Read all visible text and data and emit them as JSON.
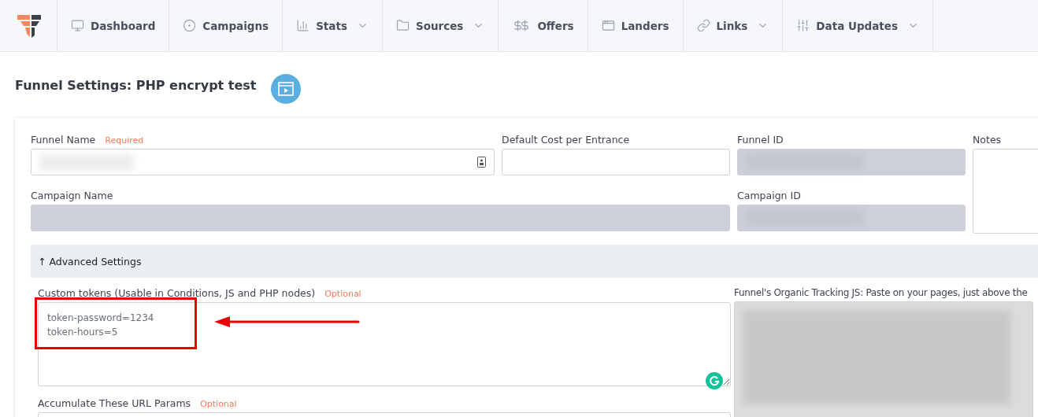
{
  "nav": {
    "items": [
      {
        "label": "Dashboard",
        "dropdown": false
      },
      {
        "label": "Campaigns",
        "dropdown": false
      },
      {
        "label": "Stats",
        "dropdown": true
      },
      {
        "label": "Sources",
        "dropdown": true
      },
      {
        "label": "Offers",
        "dropdown": false
      },
      {
        "label": "Landers",
        "dropdown": false
      },
      {
        "label": "Links",
        "dropdown": true
      },
      {
        "label": "Data Updates",
        "dropdown": true
      }
    ]
  },
  "page": {
    "title": "Funnel Settings: PHP encrypt test"
  },
  "form": {
    "funnel_name": {
      "label": "Funnel Name",
      "badge": "Required"
    },
    "default_cost": {
      "label": "Default Cost per Entrance"
    },
    "funnel_id": {
      "label": "Funnel ID"
    },
    "notes": {
      "label": "Notes"
    },
    "campaign_name": {
      "label": "Campaign Name"
    },
    "campaign_id": {
      "label": "Campaign ID"
    },
    "advanced": {
      "label": "↑ Advanced Settings",
      "expanded": true
    },
    "custom_tokens": {
      "label": "Custom tokens (Usable in Conditions, JS and PHP nodes)",
      "badge": "Optional",
      "value": "token-password=1234\ntoken-hours=5"
    },
    "tracking_js": {
      "label": "Funnel's Organic Tracking JS: Paste on your pages, just above the"
    },
    "url_params": {
      "label": "Accumulate These URL Params",
      "badge": "Optional"
    }
  }
}
